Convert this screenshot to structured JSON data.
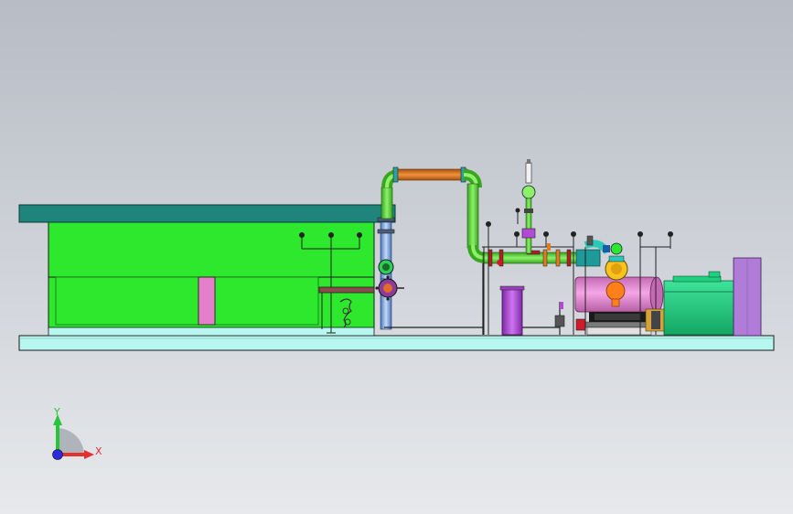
{
  "colors": {
    "background_top": "#b7bcc5",
    "background_bottom": "#e7e9ec",
    "base_skid": "#b8f7ef",
    "roof": "#1f857c",
    "building_wall": "#2de82d",
    "pillar": "#e47fc9",
    "pipe_green": "#71e04e",
    "pipe_orange": "#e07a23",
    "pipe_blue": "#7da9e6",
    "tank_pink": "#e78ed8",
    "motor_teal": "#1fd07e",
    "cabinet_purple": "#b07cd8",
    "filter_purple": "#b449d8",
    "axis_x": "#e53030",
    "axis_y": "#27c63a",
    "axis_z": "#2a2ae0"
  },
  "triad": {
    "x_label": "X",
    "y_label": "Y"
  }
}
